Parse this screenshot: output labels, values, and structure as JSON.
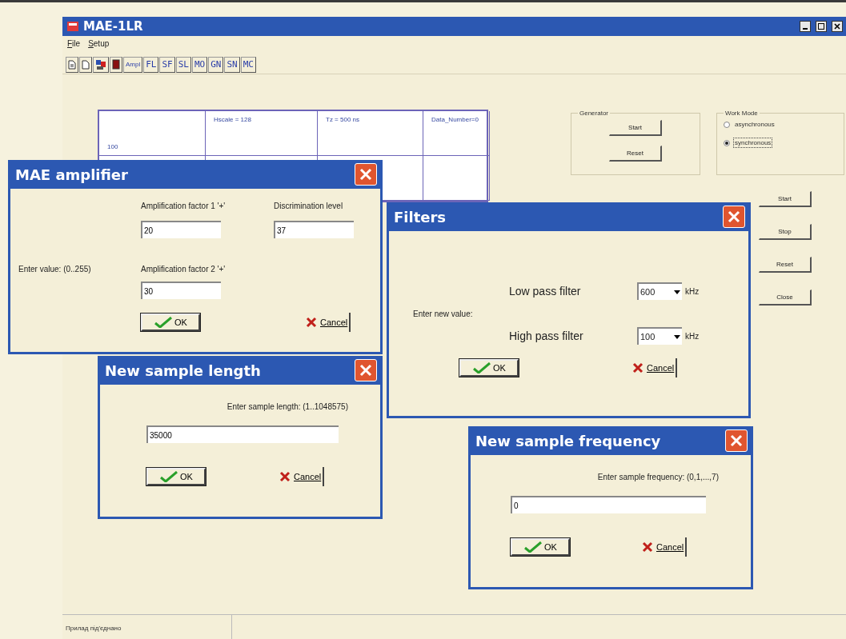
{
  "main_window": {
    "title": "MAE-1LR",
    "menu": [
      "File",
      "Setup"
    ],
    "toolbar": [
      "Ampl",
      "FL",
      "SF",
      "SL",
      "MO",
      "GN",
      "SN",
      "MC"
    ],
    "table": {
      "rows": [
        [
          "100",
          "Hscale = 128",
          "Tz = 500 ns",
          "Data_Number=0"
        ],
        [
          "",
          "",
          "",
          ""
        ]
      ]
    },
    "generator": {
      "title": "Generator",
      "buttons": [
        "Start",
        "Reset"
      ]
    },
    "work_mode": {
      "title": "Work Mode",
      "options": [
        {
          "label": "asynchronous",
          "selected": false
        },
        {
          "label": "synchronous",
          "selected": true
        }
      ]
    },
    "side_buttons": [
      "Start",
      "Stop",
      "Reset",
      "Close"
    ],
    "status_bar": [
      "Прилад під'єднано"
    ]
  },
  "amplifier_dialog": {
    "title": "MAE amplifier",
    "hint": "Enter value: (0..255)",
    "fields": [
      {
        "label": "Amplification factor 1 '+'",
        "value": "20"
      },
      {
        "label": "Discrimination level",
        "value": "37"
      },
      {
        "label": "Amplification factor 2 '+'",
        "value": "30"
      }
    ],
    "ok": "OK",
    "cancel": "Cancel"
  },
  "filters_dialog": {
    "title": "Filters",
    "hint": "Enter new value:",
    "filters": [
      {
        "label": "Low pass filter",
        "value": "600",
        "unit": "kHz"
      },
      {
        "label": "High pass filter",
        "value": "100",
        "unit": "kHz"
      }
    ],
    "ok": "OK",
    "cancel": "Cancel"
  },
  "sample_length_dialog": {
    "title": "New sample length",
    "prompt": "Enter sample length: (1..1048575)",
    "value": "35000",
    "ok": "OK",
    "cancel": "Cancel"
  },
  "sample_frequency_dialog": {
    "title": "New sample frequency",
    "prompt": "Enter sample frequency: (0,1,...,7)",
    "value": "0",
    "ok": "OK",
    "cancel": "Cancel"
  }
}
